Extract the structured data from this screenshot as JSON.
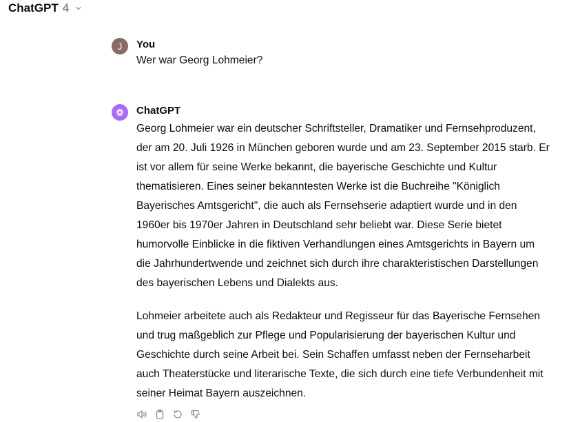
{
  "header": {
    "model_name": "ChatGPT",
    "model_version": "4"
  },
  "conversation": {
    "user_message": {
      "avatar_letter": "J",
      "author": "You",
      "text": "Wer war Georg Lohmeier?"
    },
    "assistant_message": {
      "author": "ChatGPT",
      "paragraphs": [
        "Georg Lohmeier war ein deutscher Schriftsteller, Dramatiker und Fernsehproduzent, der am 20. Juli 1926 in München geboren wurde und am 23. September 2015 starb. Er ist vor allem für seine Werke bekannt, die bayerische Geschichte und Kultur thematisieren. Eines seiner bekanntesten Werke ist die Buchreihe \"Königlich Bayerisches Amtsgericht\", die auch als Fernsehserie adaptiert wurde und in den 1960er bis 1970er Jahren in Deutschland sehr beliebt war. Diese Serie bietet humorvolle Einblicke in die fiktiven Verhandlungen eines Amtsgerichts in Bayern um die Jahrhundertwende und zeichnet sich durch ihre charakteristischen Darstellungen des bayerischen Lebens und Dialekts aus.",
        "Lohmeier arbeitete auch als Redakteur und Regisseur für das Bayerische Fernsehen und trug maßgeblich zur Pflege und Popularisierung der bayerischen Kultur und Geschichte durch seine Arbeit bei. Sein Schaffen umfasst neben der Fernseharbeit auch Theaterstücke und literarische Texte, die sich durch eine tiefe Verbundenheit mit seiner Heimat Bayern auszeichnen."
      ],
      "actions": [
        "read-aloud-icon",
        "copy-icon",
        "regenerate-icon",
        "thumbs-down-icon"
      ]
    }
  },
  "colors": {
    "user_avatar": "#8a6a62",
    "gpt_avatar": "#ab68ff",
    "version_gray": "#8e8e8e"
  }
}
